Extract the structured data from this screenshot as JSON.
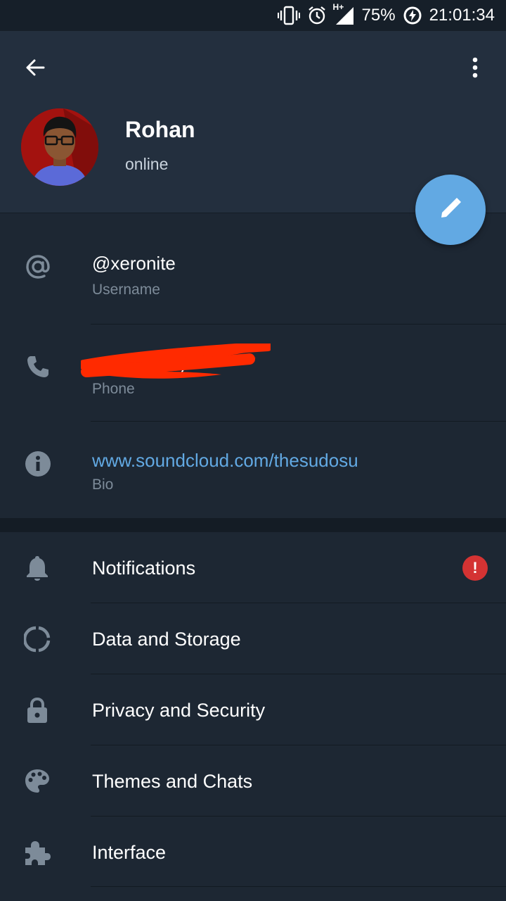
{
  "status_bar": {
    "battery": "75%",
    "time": "21:01:34",
    "network": "H+",
    "icons": [
      "vibrate-icon",
      "alarm-icon",
      "signal-icon",
      "battery-charging-icon"
    ]
  },
  "header": {
    "back_icon": "arrow-left-icon",
    "menu_icon": "more-vertical-icon",
    "name": "Rohan",
    "status": "online",
    "edit_icon": "pencil-icon",
    "colors": {
      "header_bg": "#232f3e",
      "fab": "#62a9e3"
    }
  },
  "info": [
    {
      "icon": "at-icon",
      "value": "@xeronite",
      "label": "Username"
    },
    {
      "icon": "phone-icon",
      "value": "+(redacted)",
      "label": "Phone"
    },
    {
      "icon": "info-icon",
      "value": "www.soundcloud.com/thesudosu",
      "label": "Bio"
    }
  ],
  "settings": [
    {
      "icon": "bell-icon",
      "label": "Notifications",
      "badge": "!"
    },
    {
      "icon": "data-storage-icon",
      "label": "Data and Storage"
    },
    {
      "icon": "lock-icon",
      "label": "Privacy and Security"
    },
    {
      "icon": "palette-icon",
      "label": "Themes and Chats"
    },
    {
      "icon": "puzzle-icon",
      "label": "Interface"
    }
  ],
  "colors": {
    "background": "#1d2733",
    "accent": "#62a9e3",
    "badge": "#d43333",
    "redaction": "#ff2a00"
  }
}
